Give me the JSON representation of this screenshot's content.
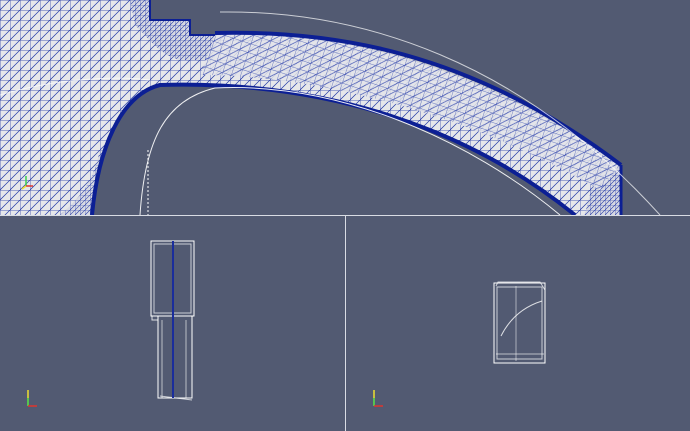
{
  "app": {
    "layout": "three-viewports",
    "colors": {
      "background": "#525a72",
      "mesh_edge": "#1a2d9c",
      "mesh_surface": "#e8e8ea",
      "outline": "#ffffff",
      "divider": "#d9dce4",
      "axis_x": "#e0342c",
      "axis_y": "#f0e030",
      "axis_z": "#3cd050"
    }
  },
  "viewports": [
    {
      "id": "top",
      "content": "triangulated-mesh-closeup",
      "axes_icon": "orientation-axes-icon"
    },
    {
      "id": "bottom-left",
      "content": "wireframe-side-view",
      "axes_icon": "orientation-axes-icon"
    },
    {
      "id": "bottom-right",
      "content": "wireframe-section-view",
      "axes_icon": "orientation-axes-icon"
    }
  ]
}
